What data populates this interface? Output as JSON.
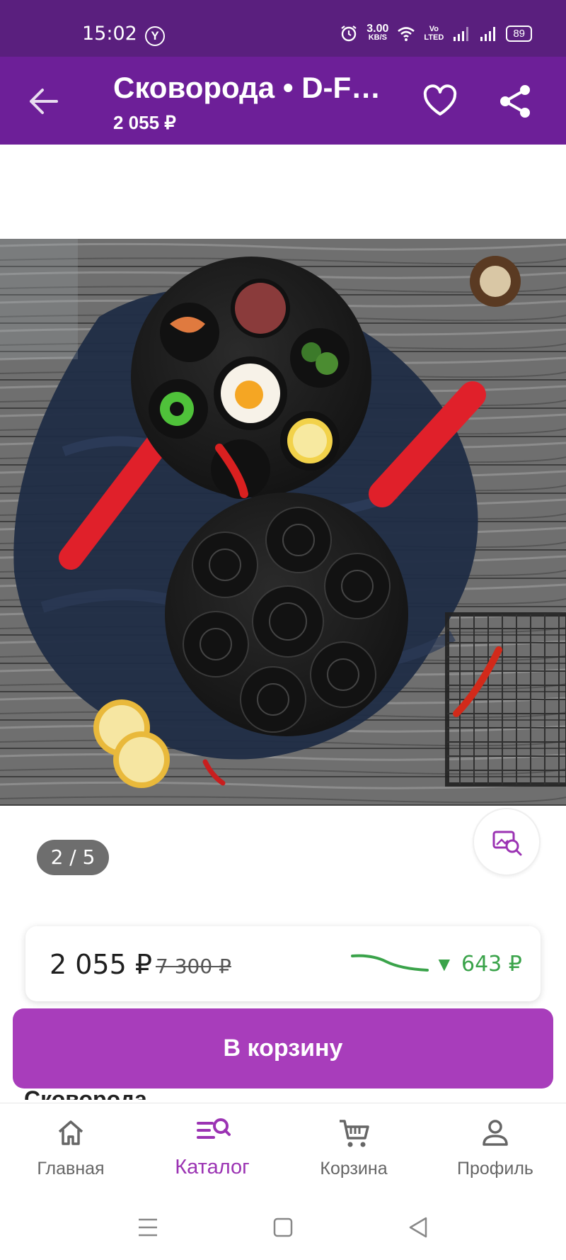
{
  "status_bar": {
    "time": "15:02",
    "carrier_icon_letter": "Y",
    "net_speed_top": "3.00",
    "net_speed_bottom": "KB/S",
    "volte_top": "Vo",
    "volte_bottom": "LTED",
    "battery": "89"
  },
  "app_bar": {
    "title": "Сковорода • D-Fa…",
    "price": "2 055 ₽"
  },
  "gallery": {
    "counter": "2 / 5"
  },
  "price_card": {
    "price": "2 055 ₽",
    "old_price": "7 300 ₽",
    "change_arrow": "▼",
    "change": "643 ₽"
  },
  "cart_button": {
    "label": "В корзину"
  },
  "partial_text": "Сковорода",
  "bottom_nav": {
    "items": [
      {
        "label": "Главная",
        "icon": "home-icon"
      },
      {
        "label": "Каталог",
        "icon": "catalog-search-icon"
      },
      {
        "label": "Корзина",
        "icon": "cart-icon"
      },
      {
        "label": "Профиль",
        "icon": "profile-icon"
      }
    ],
    "active_index": 1
  },
  "colors": {
    "status_bar": "#5a1f7e",
    "app_bar": "#6d1f98",
    "accent": "#a83dbb",
    "active_nav": "#9b33b3",
    "price_drop": "#3aa34a"
  }
}
